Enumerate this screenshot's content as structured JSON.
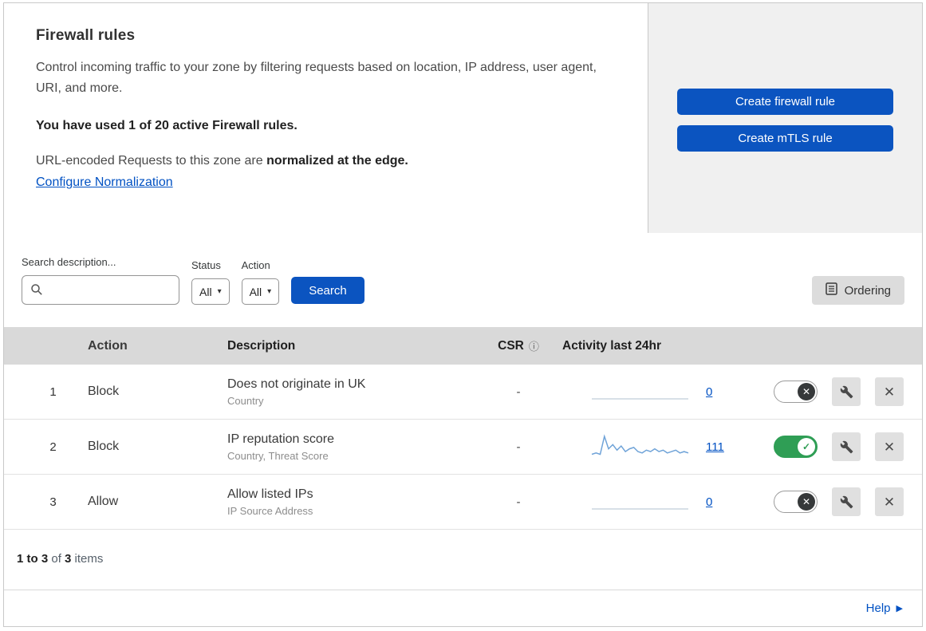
{
  "colors": {
    "primary_blue": "#0b54c0",
    "link_blue": "#0051c3",
    "toggle_green": "#2f9e55",
    "header_gray": "#d9d9d9",
    "panel_gray": "#f0f0f0",
    "spark_blue": "#6fa3d8",
    "spark_flat": "#ccd5df"
  },
  "glyphs": {
    "check": "✓",
    "cross": "✕",
    "caret": "▾",
    "info": "ⓘ",
    "delete": "✕",
    "help_arrow": "▶"
  },
  "header": {
    "title": "Firewall rules",
    "description": "Control incoming traffic to your zone by filtering requests based on location, IP address, user agent, URI, and more.",
    "usage_bold": "You have used 1 of 20 active Firewall rules.",
    "normalization_prefix": "URL-encoded Requests to this zone are ",
    "normalization_bold": "normalized at the edge.",
    "normalization_link": "Configure Normalization",
    "buttons": {
      "create_firewall": "Create firewall rule",
      "create_mtls": "Create mTLS rule"
    }
  },
  "filters": {
    "search_label": "Search description...",
    "status_label": "Status",
    "status_value": "All",
    "action_label": "Action",
    "action_value": "All",
    "search_button": "Search",
    "ordering_button": "Ordering"
  },
  "table": {
    "columns": {
      "action": "Action",
      "description": "Description",
      "csr": "CSR",
      "activity": "Activity last 24hr"
    },
    "rows": [
      {
        "index": "1",
        "action": "Block",
        "description": "Does not originate in UK",
        "fields": "Country",
        "csr": "-",
        "activity_count": "0",
        "activity_points": [],
        "enabled": false
      },
      {
        "index": "2",
        "action": "Block",
        "description": "IP reputation score",
        "fields": "Country, Threat Score",
        "csr": "-",
        "activity_count": "111",
        "activity_points": [
          2,
          3,
          2,
          15,
          6,
          9,
          5,
          8,
          4,
          6,
          7,
          4,
          3,
          5,
          4,
          6,
          4,
          5,
          3,
          4,
          5,
          3,
          4,
          3
        ],
        "enabled": true
      },
      {
        "index": "3",
        "action": "Allow",
        "description": "Allow listed IPs",
        "fields": "IP Source Address",
        "csr": "-",
        "activity_count": "0",
        "activity_points": [],
        "enabled": false
      }
    ]
  },
  "footer": {
    "range_bold": "1 to 3",
    "of_text": " of ",
    "total_bold": "3",
    "items_text": " items",
    "help_label": "Help"
  }
}
